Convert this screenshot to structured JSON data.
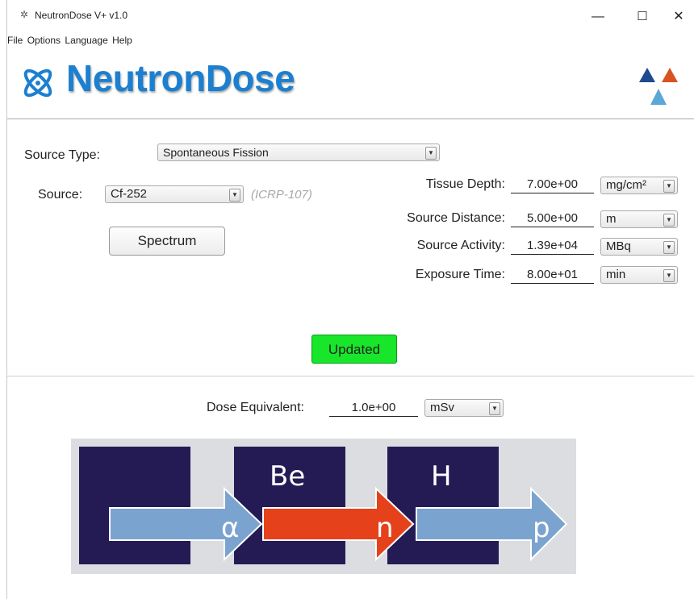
{
  "window": {
    "title": "NeutronDose  V+ v1.0",
    "minimize": "—",
    "maximize": "☐",
    "close": "✕"
  },
  "menu": [
    "File",
    "Options",
    "Language",
    "Help"
  ],
  "logo": {
    "text": "NeutronDose"
  },
  "source_type": {
    "label": "Source Type:",
    "value": "Spontaneous Fission"
  },
  "source": {
    "label": "Source:",
    "value": "Cf-252",
    "reference": "(ICRP-107)"
  },
  "spectrum_button": "Spectrum",
  "params": [
    {
      "label": "Tissue Depth:",
      "value": "7.00e+00",
      "unit": "mg/cm²"
    },
    {
      "label": "Source Distance:",
      "value": "5.00e+00",
      "unit": "m"
    },
    {
      "label": "Source Activity:",
      "value": "1.39e+04",
      "unit": "MBq"
    },
    {
      "label": "Exposure Time:",
      "value": "8.00e+01",
      "unit": "min"
    }
  ],
  "status": "Updated",
  "dose": {
    "label": "Dose Equivalent:",
    "value": "1.0e+00",
    "unit": "mSv"
  },
  "reaction": {
    "blocks": [
      "",
      "Be",
      "H"
    ],
    "arrows": [
      "α",
      "n",
      "p"
    ],
    "colors": {
      "block": "#241b55",
      "alpha_arrow": "#7ba3cf",
      "neutron_arrow": "#e5421c",
      "proton_arrow": "#7ba3cf"
    }
  },
  "colors": {
    "logo_blue": "#1c7fd0",
    "updated_green": "#18e62a"
  }
}
